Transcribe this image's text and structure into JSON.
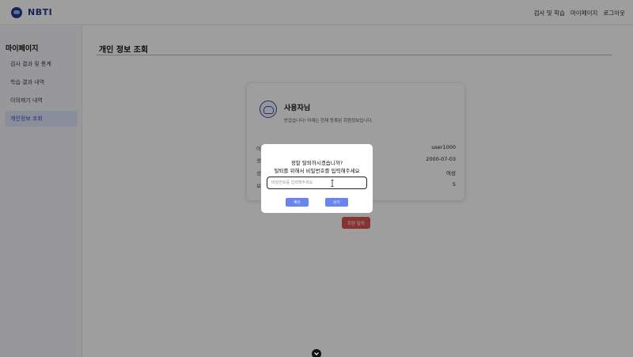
{
  "header": {
    "logo_text": "NBTI",
    "nav": [
      "검사 및 학습",
      "마이페이지",
      "로그아웃"
    ]
  },
  "sidebar": {
    "title": "마이페이지",
    "items": [
      {
        "label": "검사 결과 및 통계",
        "active": false
      },
      {
        "label": "학습 결과 내역",
        "active": false
      },
      {
        "label": "이의제기 내역",
        "active": false
      },
      {
        "label": "개인정보 조회",
        "active": true
      }
    ]
  },
  "page": {
    "title": "개인 정보 조회"
  },
  "card": {
    "name": "사용자님",
    "message": "반갑습니다! 아래는 현재 등록된 회원정보입니다.",
    "rows": [
      {
        "label": "아",
        "value": "user1000"
      },
      {
        "label": "생",
        "value": "2000-07-03"
      },
      {
        "label": "성",
        "value": "여성"
      },
      {
        "label": "보",
        "value": "5"
      }
    ]
  },
  "withdraw_button": "회원 탈퇴",
  "modal": {
    "question": "정말 탈퇴하시겠습니까?",
    "instruction": "탈퇴를 위해서 비밀번호를 입력해주세요",
    "input_placeholder": "비밀번호를 입력해주세요",
    "input_value": "",
    "confirm_label": "확인",
    "close_label": "닫기"
  },
  "colors": {
    "brand": "#243b8f",
    "sidebar_active_bg": "#dfe6fb",
    "modal_button": "#6a86ee",
    "danger": "#d9534f"
  },
  "icons": {
    "logo": "brain-logo-icon",
    "avatar": "user-avatar-icon",
    "scroll": "chevron-down-icon"
  }
}
